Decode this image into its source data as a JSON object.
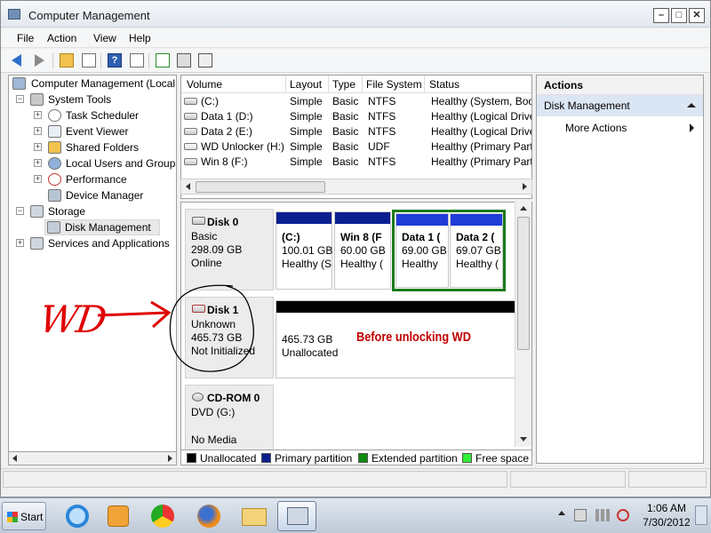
{
  "window": {
    "title": "Computer Management"
  },
  "menu": [
    "File",
    "Action",
    "View",
    "Help"
  ],
  "tree": {
    "root": "Computer Management (Local",
    "system_tools": "System Tools",
    "task_scheduler": "Task Scheduler",
    "event_viewer": "Event Viewer",
    "shared_folders": "Shared Folders",
    "local_users": "Local Users and Groups",
    "performance": "Performance",
    "device_manager": "Device Manager",
    "storage": "Storage",
    "disk_management": "Disk Management",
    "services": "Services and Applications"
  },
  "volumes": {
    "headers": [
      "Volume",
      "Layout",
      "Type",
      "File System",
      "Status"
    ],
    "rows": [
      {
        "volume": "(C:)",
        "layout": "Simple",
        "type": "Basic",
        "fs": "NTFS",
        "status": "Healthy (System, Boo"
      },
      {
        "volume": "Data 1 (D:)",
        "layout": "Simple",
        "type": "Basic",
        "fs": "NTFS",
        "status": "Healthy (Logical Drive"
      },
      {
        "volume": "Data 2 (E:)",
        "layout": "Simple",
        "type": "Basic",
        "fs": "NTFS",
        "status": "Healthy (Logical Drive"
      },
      {
        "volume": "WD Unlocker (H:)",
        "layout": "Simple",
        "type": "Basic",
        "fs": "UDF",
        "status": "Healthy (Primary Part"
      },
      {
        "volume": "Win 8 (F:)",
        "layout": "Simple",
        "type": "Basic",
        "fs": "NTFS",
        "status": "Healthy (Primary Part"
      }
    ]
  },
  "disks": {
    "disk0": {
      "name": "Disk 0",
      "kind": "Basic",
      "size": "298.09 GB",
      "state": "Online",
      "parts": [
        {
          "name": "(C:)",
          "size": "100.01 GB",
          "status": "Healthy (S"
        },
        {
          "name": "Win 8  (F",
          "size": "60.00 GB",
          "status": "Healthy ("
        },
        {
          "name": "Data 1  (",
          "size": "69.00 GB",
          "status": "Healthy"
        },
        {
          "name": "Data 2  (",
          "size": "69.07 GB",
          "status": "Healthy ("
        }
      ]
    },
    "disk1": {
      "name": "Disk 1",
      "kind": "Unknown",
      "size": "465.73 GB",
      "state": "Not Initialized",
      "part": {
        "size": "465.73 GB",
        "status": "Unallocated"
      }
    },
    "cdrom0": {
      "name": "CD-ROM 0",
      "kind": "DVD (G:)",
      "state": "No Media"
    }
  },
  "legend": [
    {
      "label": "Unallocated",
      "color": "#000000"
    },
    {
      "label": "Primary partition",
      "color": "#0a1f8f"
    },
    {
      "label": "Extended partition",
      "color": "#0f8a0f"
    },
    {
      "label": "Free space",
      "color": "#33ee33"
    }
  ],
  "actions": {
    "header": "Actions",
    "section": "Disk Management",
    "more": "More Actions"
  },
  "annotations": {
    "wd": "WD",
    "note": "Before unlocking WD"
  },
  "taskbar": {
    "start": "Start",
    "time": "1:06 AM",
    "date": "7/30/2012"
  },
  "colors": {
    "primary": "#0a1f8f",
    "logical": "#1f3cd8",
    "selected_border": "#1a7a1a",
    "annotation": "#e00000"
  }
}
